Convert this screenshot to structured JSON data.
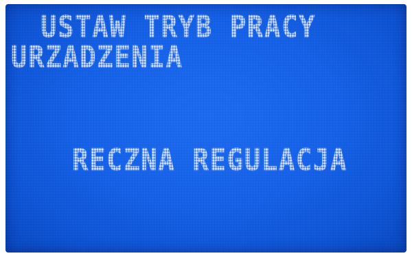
{
  "display": {
    "title_line_1": " USTAW TRYB PRACY",
    "title_line_2": "URZADZENIA",
    "mode_value": "RECZNA REGULACJA",
    "colors": {
      "background": "#1763ea",
      "text": "#d9e6ff"
    }
  }
}
